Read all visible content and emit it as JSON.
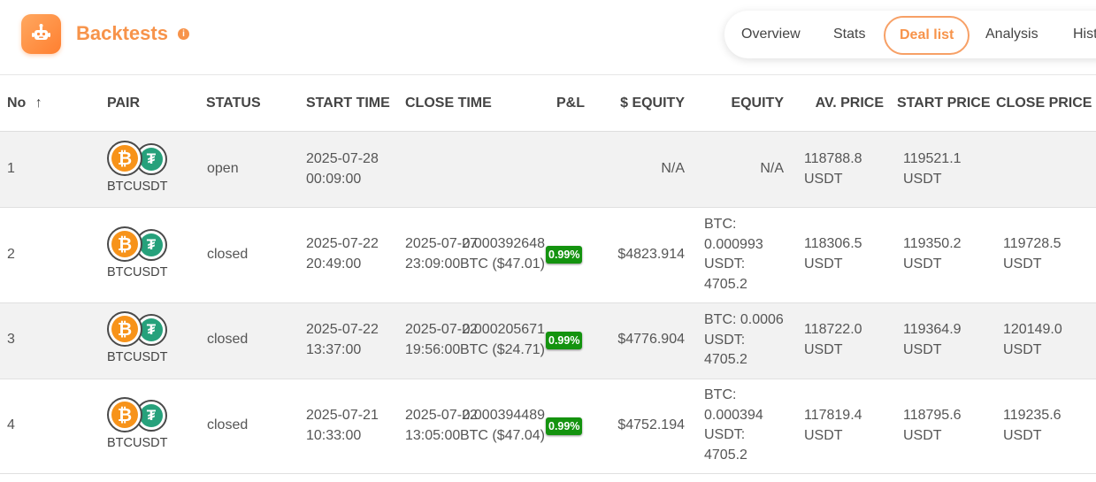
{
  "header": {
    "title": "Backtests",
    "info_icon": "i",
    "tabs": [
      {
        "label": "Overview"
      },
      {
        "label": "Stats"
      },
      {
        "label": "Deal list",
        "active": true
      },
      {
        "label": "Analysis"
      },
      {
        "label": "Hist"
      }
    ]
  },
  "table": {
    "columns": {
      "no": "No",
      "no_sort_icon": "↑",
      "pair": "PAIR",
      "status": "STATUS",
      "start_time": "START TIME",
      "close_time": "CLOSE TIME",
      "pnl": "P&L",
      "usd_equity": "$ EQUITY",
      "equity": "EQUITY",
      "av_price": "AV. PRICE",
      "start_price": "START PRICE",
      "close_price": "CLOSE PRICE"
    },
    "rows": [
      {
        "no": "1",
        "pair": "BTCUSDT",
        "status": "open",
        "start_time": [
          "2025-07-28",
          "00:09:00"
        ],
        "close_time": [
          "",
          ""
        ],
        "pnl_text": [
          "",
          ""
        ],
        "pnl_badge": "",
        "usd_equity": "N/A",
        "equity": [
          "N/A"
        ],
        "av_price": [
          "118788.8",
          "USDT"
        ],
        "start_price": [
          "119521.1",
          "USDT"
        ],
        "close_price": [
          "",
          ""
        ]
      },
      {
        "no": "2",
        "pair": "BTCUSDT",
        "status": "closed",
        "start_time": [
          "2025-07-22",
          "20:49:00"
        ],
        "close_time": [
          "2025-07-27",
          "23:09:00"
        ],
        "pnl_text": [
          "0.000392648",
          "BTC ($47.01)"
        ],
        "pnl_badge": "0.99%",
        "usd_equity": "$4823.914",
        "equity": [
          "BTC:",
          "0.000993",
          "USDT:",
          "4705.2"
        ],
        "av_price": [
          "118306.5",
          "USDT"
        ],
        "start_price": [
          "119350.2",
          "USDT"
        ],
        "close_price": [
          "119728.5",
          "USDT"
        ]
      },
      {
        "no": "3",
        "pair": "BTCUSDT",
        "status": "closed",
        "start_time": [
          "2025-07-22",
          "13:37:00"
        ],
        "close_time": [
          "2025-07-22",
          "19:56:00"
        ],
        "pnl_text": [
          "0.000205671",
          "BTC ($24.71)"
        ],
        "pnl_badge": "0.99%",
        "usd_equity": "$4776.904",
        "equity": [
          "BTC: 0.0006",
          "USDT:",
          "4705.2"
        ],
        "av_price": [
          "118722.0",
          "USDT"
        ],
        "start_price": [
          "119364.9",
          "USDT"
        ],
        "close_price": [
          "120149.0",
          "USDT"
        ]
      },
      {
        "no": "4",
        "pair": "BTCUSDT",
        "status": "closed",
        "start_time": [
          "2025-07-21",
          "10:33:00"
        ],
        "close_time": [
          "2025-07-22",
          "13:05:00"
        ],
        "pnl_text": [
          "0.000394489",
          "BTC ($47.04)"
        ],
        "pnl_badge": "0.99%",
        "usd_equity": "$4752.194",
        "equity": [
          "BTC:",
          "0.000394",
          "USDT:",
          "4705.2"
        ],
        "av_price": [
          "117819.4",
          "USDT"
        ],
        "start_price": [
          "118795.6",
          "USDT"
        ],
        "close_price": [
          "119235.6",
          "USDT"
        ]
      }
    ]
  },
  "icons": {
    "logo": "robot-icon",
    "btc": "₿",
    "usdt": "₮"
  },
  "colors": {
    "accent": "#f7934a",
    "badge_green": "#14930f",
    "btc": "#f7931a",
    "usdt": "#26a17b"
  }
}
